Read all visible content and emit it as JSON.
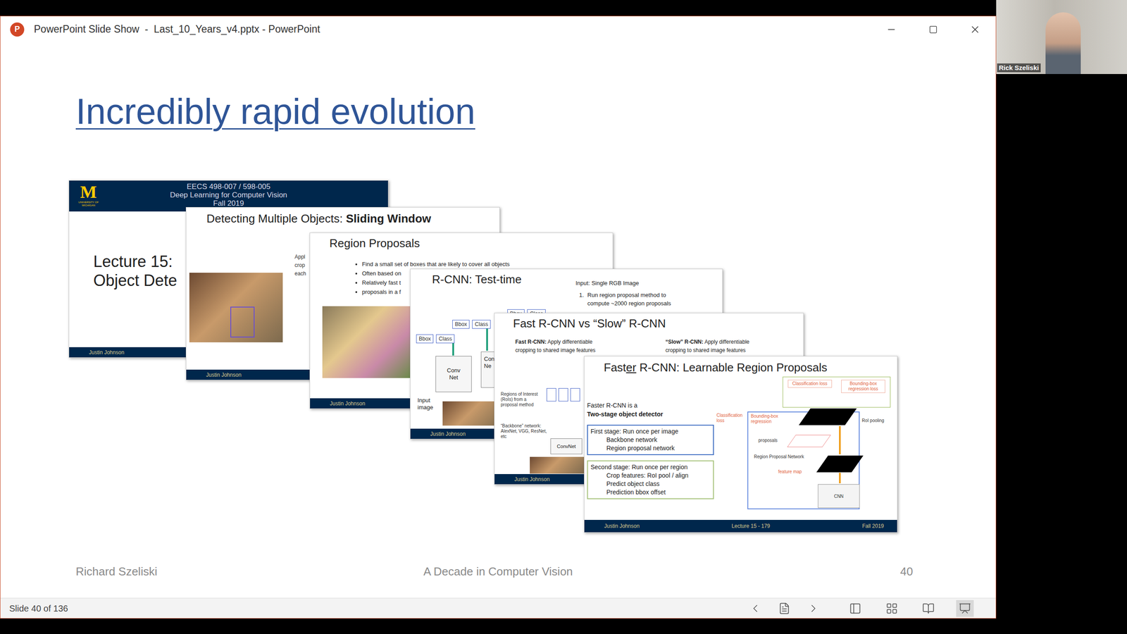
{
  "window": {
    "title": "PowerPoint Slide Show  -  Last_10_Years_v4.pptx - PowerPoint",
    "app_icon": "P"
  },
  "participant": {
    "name": "Rick Szeliski"
  },
  "slide": {
    "title": "Incredibly rapid evolution",
    "footer_left": "Richard Szeliski",
    "footer_center": "A Decade in Computer Vision",
    "number": "40"
  },
  "thumbnails": [
    {
      "kind": "title",
      "logo": "M",
      "logo_sub": "UNIVERSITY OF MICHIGAN",
      "header": [
        "EECS 498-007 / 598-005",
        "Deep Learning for Computer Vision",
        "Fall 2019"
      ],
      "lines": [
        "Lecture 15:",
        "Object Dete"
      ],
      "footer": [
        "Justin Johnson"
      ]
    },
    {
      "kind": "sliding-window",
      "title_parts": [
        {
          "text": "Detecting Multiple Objects: ",
          "bold": false,
          "underline": false
        },
        {
          "text": "Sliding Window",
          "bold": true,
          "underline": false
        }
      ],
      "side_lines": [
        "Appl",
        "crop",
        "each"
      ],
      "footer": [
        "Justin Johnson"
      ]
    },
    {
      "kind": "region-proposals",
      "title": "Region Proposals",
      "bullets": [
        "Find a small set of boxes that are likely to cover all objects",
        "Often based on",
        "Relatively fast t",
        "proposals in a f"
      ],
      "footer": [
        "Justin Johnson"
      ]
    },
    {
      "kind": "rcnn",
      "title": "R-CNN: Test-time",
      "input": "Input: Single RGB Image",
      "steps": [
        {
          "marker": "1.",
          "lines": [
            "Run region proposal method to",
            "compute ~2000 region proposals"
          ]
        }
      ],
      "outputs": [
        [
          "Bbox",
          "Class"
        ],
        [
          "Bbox",
          "Class"
        ],
        [
          "Bbox",
          "Class"
        ]
      ],
      "net": "Conv Net",
      "net_partial": "Con Ne",
      "input_label": "Input image",
      "footer": [
        "Justin Johnson"
      ]
    },
    {
      "kind": "fast-rcnn",
      "title": "Fast R-CNN vs “Slow” R-CNN",
      "columns": [
        {
          "bold": "Fast R-CNN:",
          "lines": [
            "Apply differentiable",
            "cropping to shared image features"
          ]
        },
        {
          "bold": "“Slow” R-CNN:",
          "lines": [
            "Apply differentiable",
            "cropping to shared image features"
          ]
        }
      ],
      "rois": "Regions of Interest (RoIs) from a proposal method",
      "backbone": "“Backbone” network: AlexNet, VGG, ResNet, etc",
      "net": "ConvNet",
      "footer": [
        "Justin Johnson"
      ]
    },
    {
      "kind": "faster-rcnn",
      "title_parts": [
        {
          "text": "Fast",
          "bold": false,
          "underline": false
        },
        {
          "text": "er",
          "bold": false,
          "underline": true
        },
        {
          "text": " R-CNN: Learnable Region Proposals",
          "bold": false,
          "underline": false
        }
      ],
      "intro": "Faster R-CNN is a",
      "intro_bold": "Two-stage object detector",
      "stages": [
        [
          "First stage: Run once per image",
          "Backbone network",
          "Region proposal network"
        ],
        [
          "Second stage: Run once per region",
          "Crop features: RoI pool / align",
          "Predict object class",
          "Prediction bbox offset"
        ]
      ],
      "top_losses": [
        "Classification loss",
        "Bounding-box regression loss"
      ],
      "rpn_losses": [
        "Classification loss",
        "Bounding-box regression"
      ],
      "roi_pooling": "RoI pooling",
      "proposals": "proposals",
      "rpn": "Region Proposal Network",
      "feature_map": "feature map",
      "cnn": "CNN",
      "footer": [
        "Justin Johnson",
        "Lecture 15 - 179",
        "Fall 2019"
      ]
    }
  ],
  "status_bar": {
    "slide_indicator": "Slide 40 of 136",
    "view_buttons": [
      {
        "selected": false
      },
      {
        "selected": false
      },
      {
        "selected": false
      },
      {
        "selected": true
      }
    ]
  }
}
